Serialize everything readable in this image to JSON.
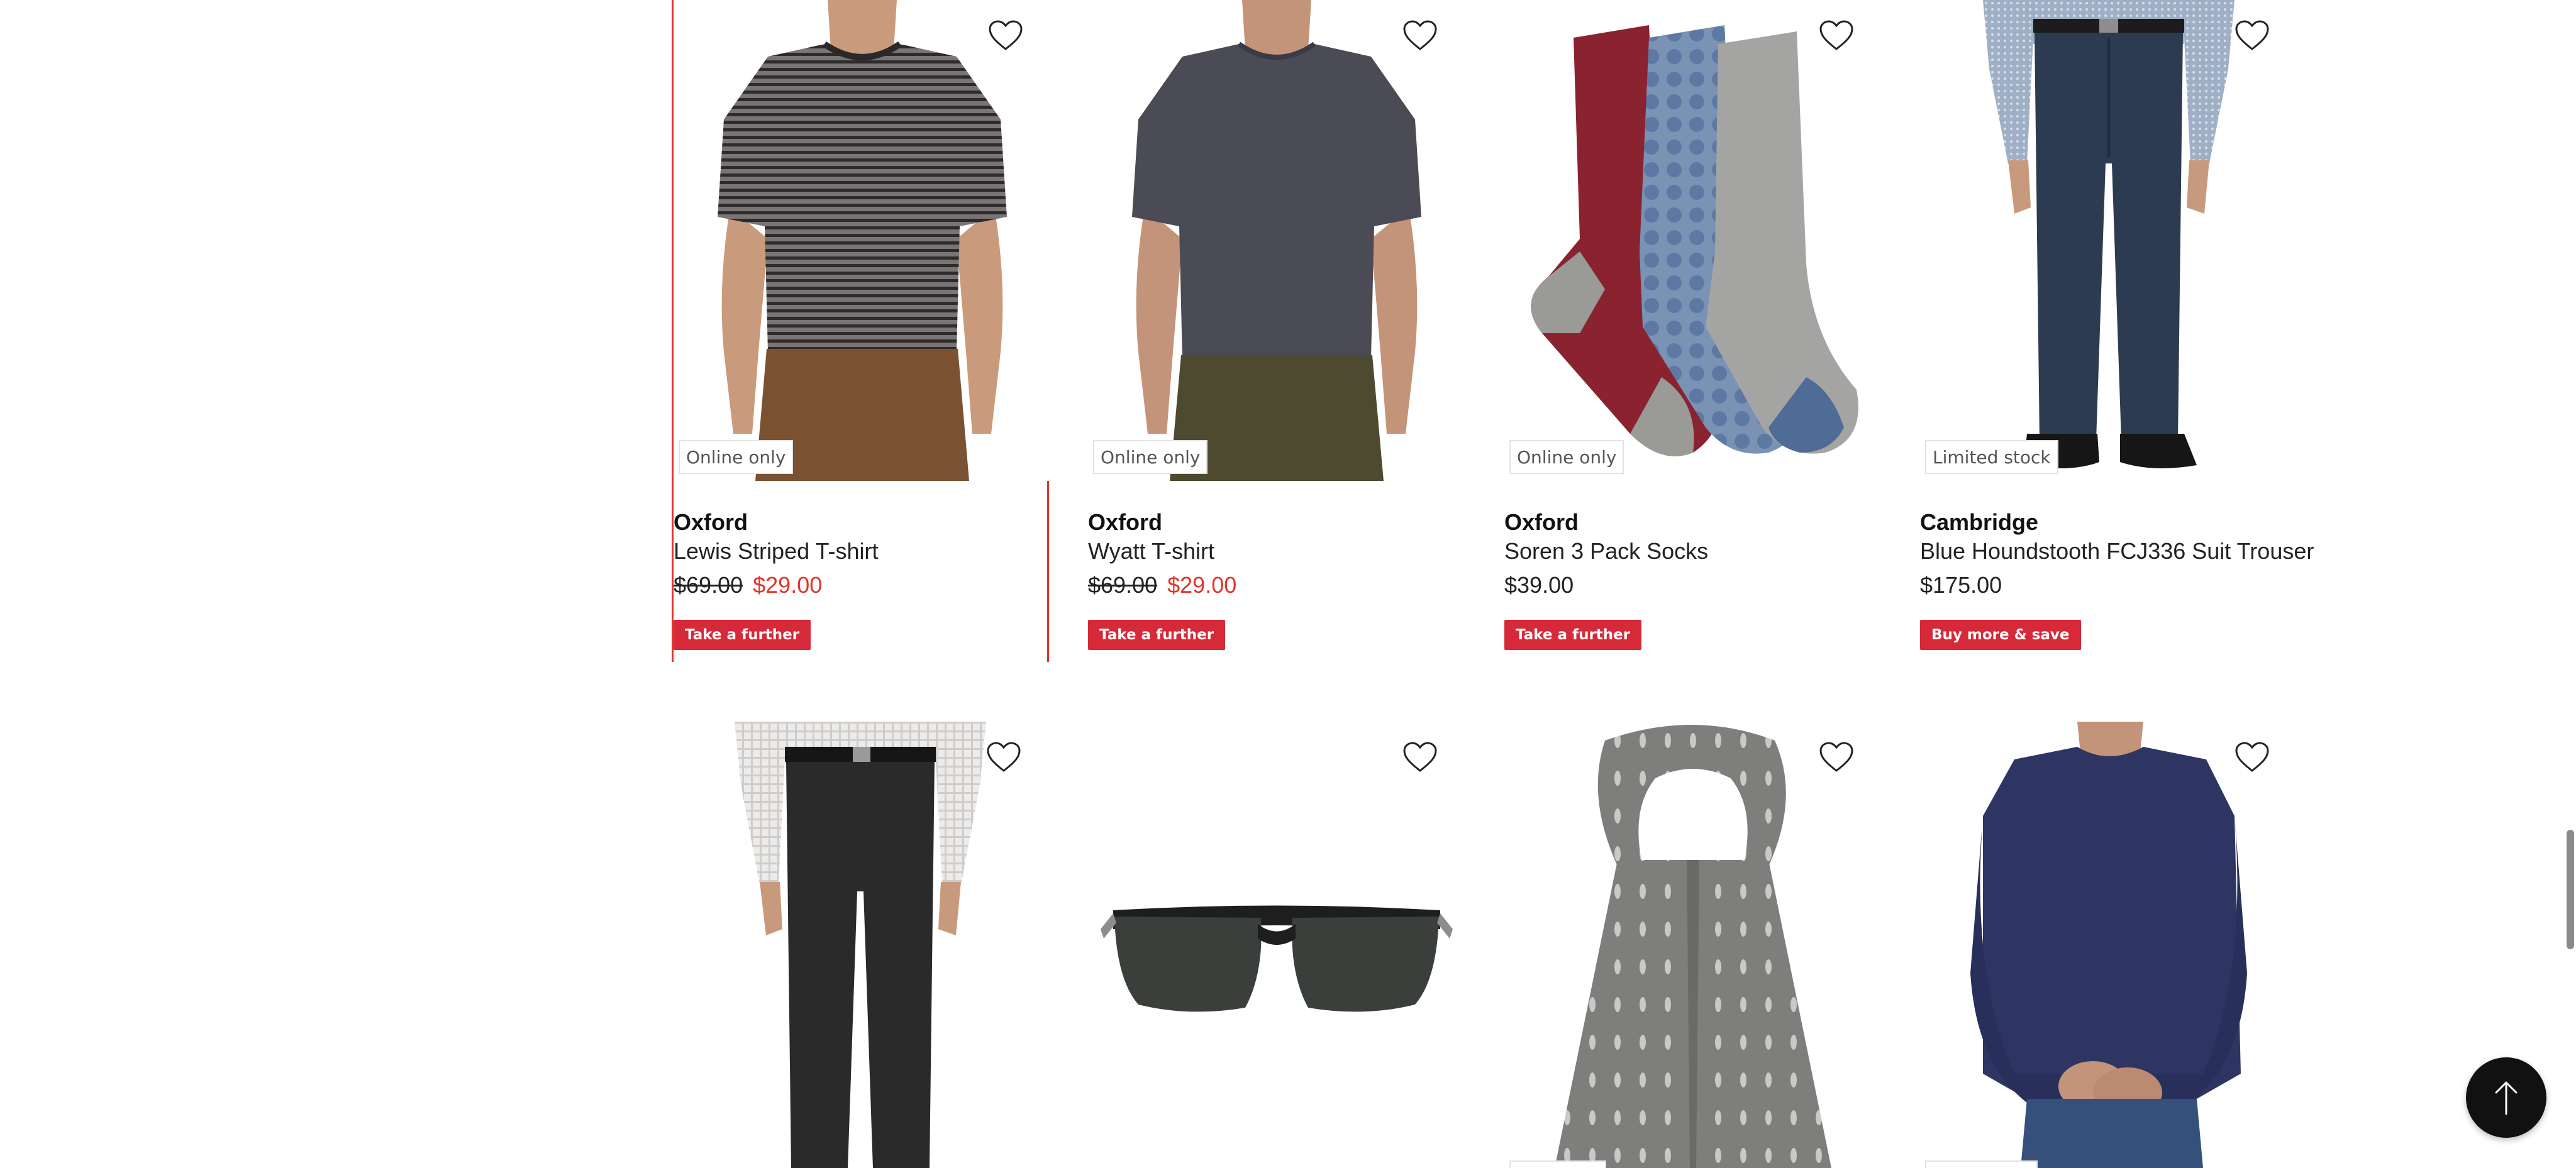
{
  "products": [
    {
      "brand": "Oxford",
      "name": "Lewis Striped T-shirt",
      "price_was": "$69.00",
      "price_now": "$29.00",
      "badge": "Online only",
      "promo": "Take a further"
    },
    {
      "brand": "Oxford",
      "name": "Wyatt T-shirt",
      "price_was": "$69.00",
      "price_now": "$29.00",
      "badge": "Online only",
      "promo": "Take a further"
    },
    {
      "brand": "Oxford",
      "name": "Soren 3 Pack Socks",
      "price": "$39.00",
      "badge": "Online only",
      "promo": "Take a further"
    },
    {
      "brand": "Cambridge",
      "name": "Blue Houndstooth FCJ336 Suit Trouser",
      "price": "$175.00",
      "badge": "Limited stock",
      "promo": "Buy more & save"
    },
    {
      "image": "charcoal-suit-trouser"
    },
    {
      "image": "black-sunglasses"
    },
    {
      "image": "grey-patterned-scarf"
    },
    {
      "image": "navy-long-sleeve-top"
    }
  ],
  "icons": {
    "wishlist": "heart-outline-icon",
    "back_to_top": "arrow-up-icon"
  },
  "colors": {
    "sale_price": "#e0352b",
    "promo_bg": "#d6293a",
    "focus_outline": "#e0352b"
  }
}
